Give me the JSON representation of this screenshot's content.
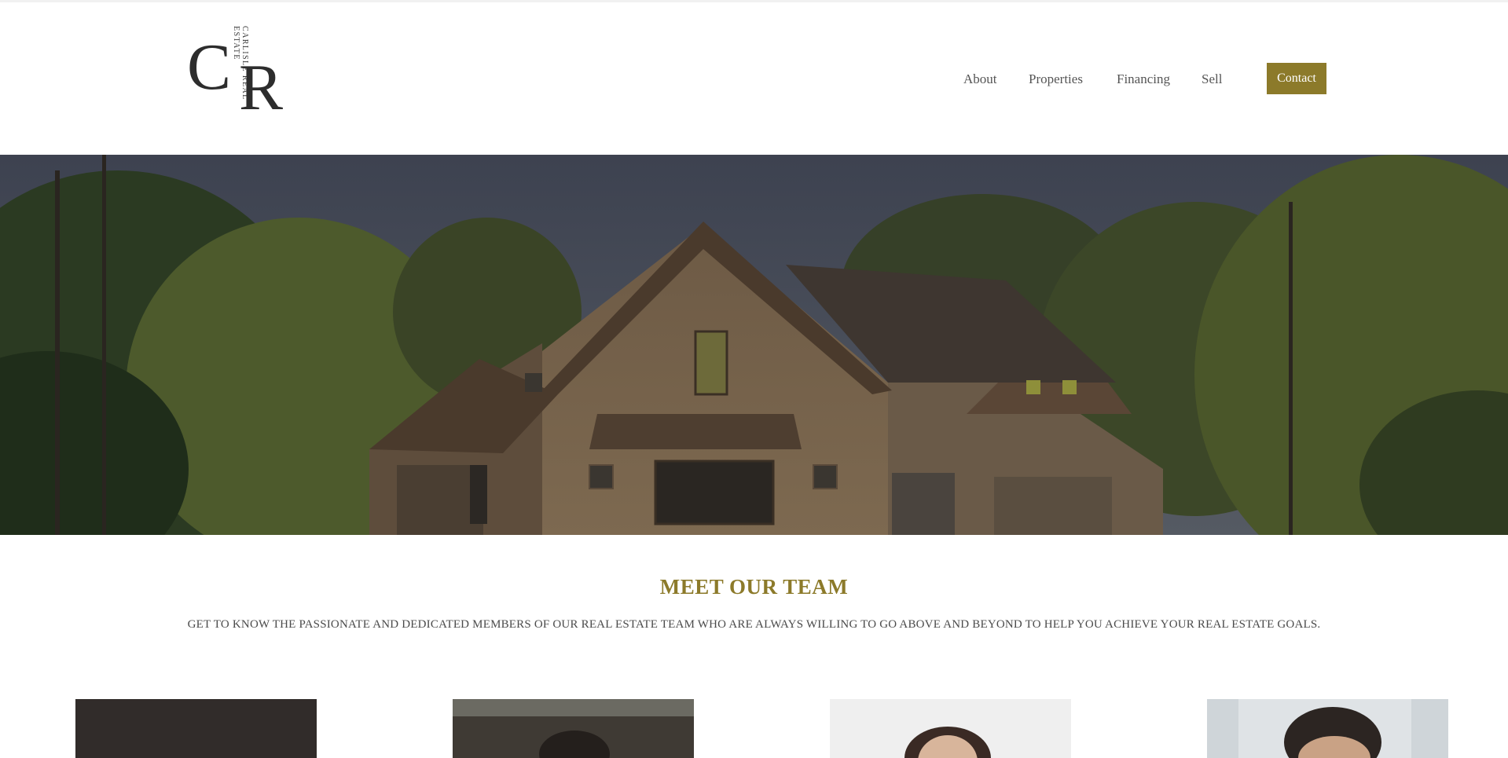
{
  "brand": {
    "monogram_left": "C",
    "monogram_right": "R",
    "vertical_text": "CARLISLE REAL ESTATE"
  },
  "nav": {
    "items": [
      {
        "label": "About"
      },
      {
        "label": "Properties"
      },
      {
        "label": "Financing"
      },
      {
        "label": "Sell"
      }
    ],
    "contact_label": "Contact"
  },
  "colors": {
    "accent": "#8c7a2a",
    "text": "#555555"
  },
  "team": {
    "title": "MEET OUR TEAM",
    "subtitle": "GET TO KNOW THE PASSIONATE AND DEDICATED MEMBERS OF OUR REAL ESTATE TEAM WHO ARE ALWAYS WILLING TO GO ABOVE AND BEYOND TO HELP YOU ACHIEVE YOUR REAL ESTATE GOALS."
  }
}
